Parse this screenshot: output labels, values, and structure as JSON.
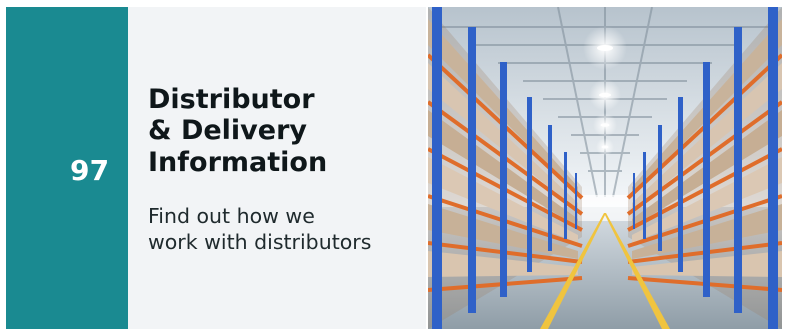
{
  "card": {
    "page_number": "97",
    "title_lines": [
      "Distributor",
      "& Delivery",
      "Information"
    ],
    "subtitle_lines": [
      "Find out how we",
      "work with distributors"
    ]
  },
  "colors": {
    "accent": "#1a8a91",
    "panel": "#f2f4f6",
    "title_text": "#0f171a",
    "body_text": "#1f2a2d"
  }
}
